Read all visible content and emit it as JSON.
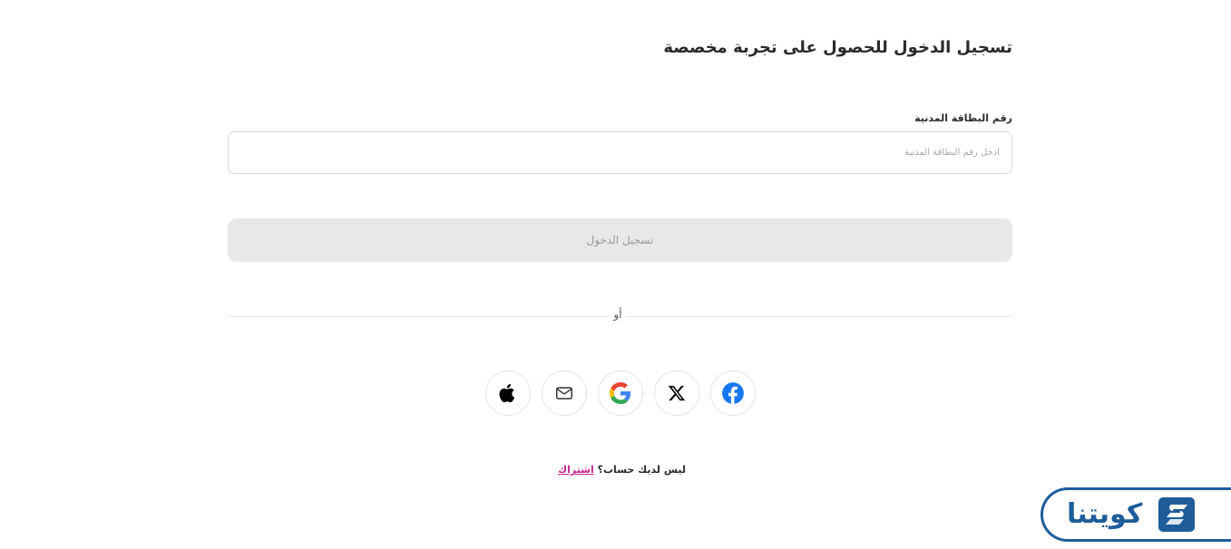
{
  "header": {
    "title": "تسجيل الدخول للحصول على تجربة مخصصة"
  },
  "civil_id_field": {
    "label": "رقم البطاقة المدنية",
    "placeholder": "أدخل رقم البطاقة المدنية",
    "value": ""
  },
  "login_button": {
    "label": "تسجيل الدخول"
  },
  "divider": {
    "text": "أو"
  },
  "social_buttons": [
    {
      "name": "apple",
      "icon": "apple-icon"
    },
    {
      "name": "email",
      "icon": "mail-icon"
    },
    {
      "name": "google",
      "icon": "google-icon"
    },
    {
      "name": "x",
      "icon": "x-icon"
    },
    {
      "name": "facebook",
      "icon": "facebook-icon"
    }
  ],
  "signup": {
    "prompt": "ليس لديك حساب؟",
    "link_label": "اشتراك"
  },
  "brand": {
    "logo_text": "كويتنا",
    "color": "#1e5d9a"
  },
  "colors": {
    "link": "#c2278b",
    "button_disabled_bg": "#e8e8e8",
    "facebook": "#1877f2"
  }
}
